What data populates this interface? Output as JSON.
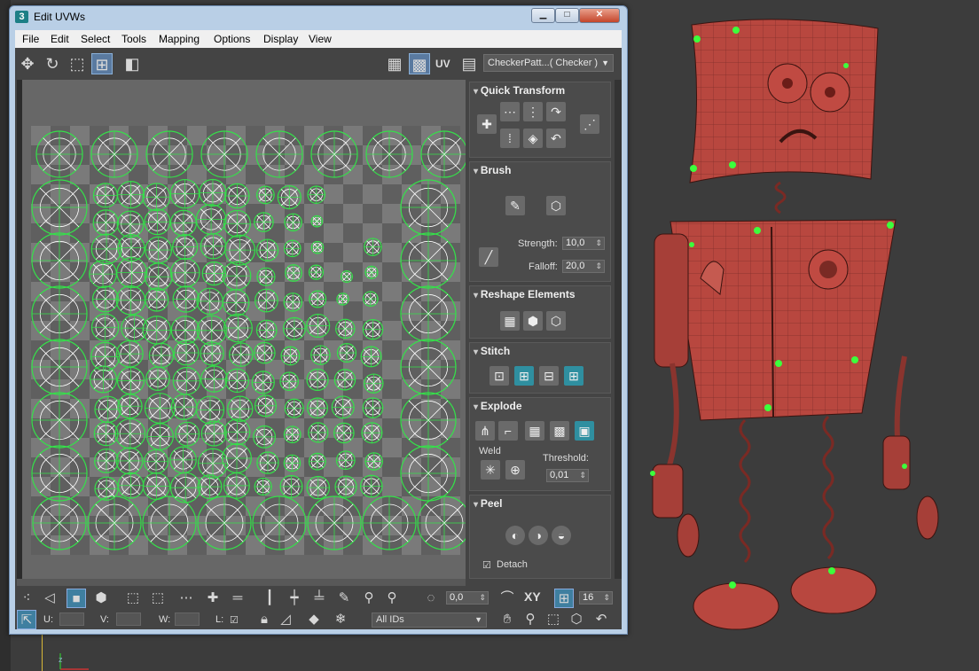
{
  "window": {
    "app_icon_text": "3",
    "title": "Edit UVWs",
    "minimize_glyph": "▁",
    "maximize_glyph": "□",
    "close_glyph": "✕"
  },
  "menu": [
    "File",
    "Edit",
    "Select",
    "Tools",
    "Mapping",
    "Options",
    "Display",
    "View"
  ],
  "toolbar": {
    "uv_label": "UV",
    "checker_dropdown": "CheckerPatt...( Checker )",
    "icons": [
      "move-icon",
      "rotate-icon",
      "scale-icon",
      "freeform-icon",
      "mirror-icon",
      "checker-toggle-icon",
      "checker-icon",
      "uv-texture-icon"
    ]
  },
  "panel": {
    "quick_transform": {
      "title": "Quick Transform"
    },
    "brush": {
      "title": "Brush",
      "strength_label": "Strength:",
      "strength_value": "10,0",
      "falloff_label": "Falloff:",
      "falloff_value": "20,0"
    },
    "reshape": {
      "title": "Reshape Elements"
    },
    "stitch": {
      "title": "Stitch"
    },
    "explode": {
      "title": "Explode",
      "weld_label": "Weld",
      "threshold_label": "Threshold:",
      "threshold_value": "0,01"
    },
    "peel": {
      "title": "Peel",
      "detach_label": "Detach"
    }
  },
  "bottom": {
    "rotate_value": "0,0",
    "xy_label": "XY",
    "grid_value": "16",
    "u_label": "U:",
    "v_label": "V:",
    "w_label": "W:",
    "l_label": "L:",
    "ids_dropdown": "All IDs"
  },
  "colors": {
    "uv_wire": "#ffffff",
    "uv_border": "#35e04a",
    "robot_body": "#b8473f",
    "accent": "#2f8fa0"
  }
}
